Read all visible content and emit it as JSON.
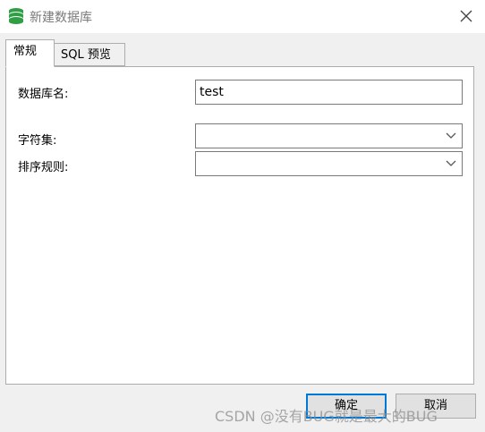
{
  "window": {
    "title": "新建数据库",
    "icon": "database-icon",
    "close_icon": "close-icon"
  },
  "tabs": [
    {
      "label": "常规",
      "active": true
    },
    {
      "label": "SQL 预览",
      "active": false
    }
  ],
  "form": {
    "db_name_label": "数据库名:",
    "db_name_value": "test",
    "charset_label": "字符集:",
    "charset_value": "",
    "collation_label": "排序规则:",
    "collation_value": ""
  },
  "buttons": {
    "ok_label": "确定",
    "cancel_label": "取消"
  },
  "watermark": "CSDN @没有BUG就是最大的BUG",
  "colors": {
    "accent": "#0078d7",
    "icon_green": "#2f9e44",
    "dialog_bg": "#f0f0f0"
  }
}
